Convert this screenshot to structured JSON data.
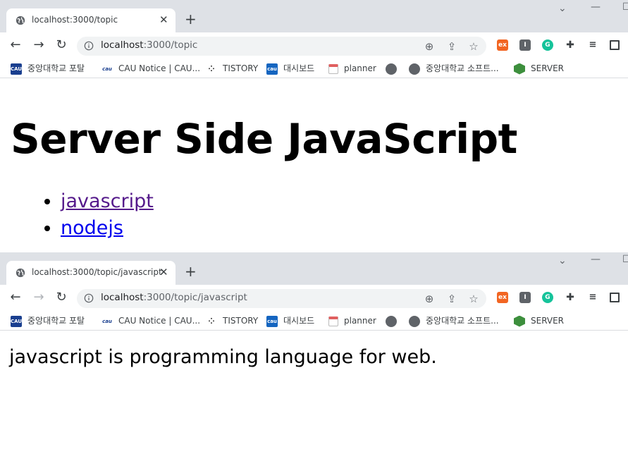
{
  "windows": [
    {
      "tab_title": "localhost:3000/topic",
      "url_host": "localhost",
      "url_path": ":3000/topic",
      "heading": "Server Side JavaScript",
      "links": [
        "javascript",
        "nodejs"
      ]
    },
    {
      "tab_title": "localhost:3000/topic/javascript",
      "url_host": "localhost",
      "url_path": ":3000/topic/javascript",
      "body_text": "javascript is programming language for web."
    }
  ],
  "bookmarks": [
    {
      "label": "중앙대학교 포탈",
      "icon": "cau-icon"
    },
    {
      "label": "CAU Notice | CAU...",
      "icon": "cau-notice-icon"
    },
    {
      "label": "TISTORY",
      "icon": "tistory-icon"
    },
    {
      "label": "대시보드",
      "icon": "dashboard-icon"
    },
    {
      "label": "planner",
      "icon": "calendar-icon"
    },
    {
      "label": "",
      "icon": "globe-icon"
    },
    {
      "label": "중앙대학교 소프트...",
      "icon": "globe-icon"
    },
    {
      "label": "SERVER",
      "icon": "nodejs-icon"
    }
  ],
  "colors": {
    "tabstrip": "#dee1e6",
    "visited_link": "#551a8b",
    "link": "#0000ee"
  }
}
